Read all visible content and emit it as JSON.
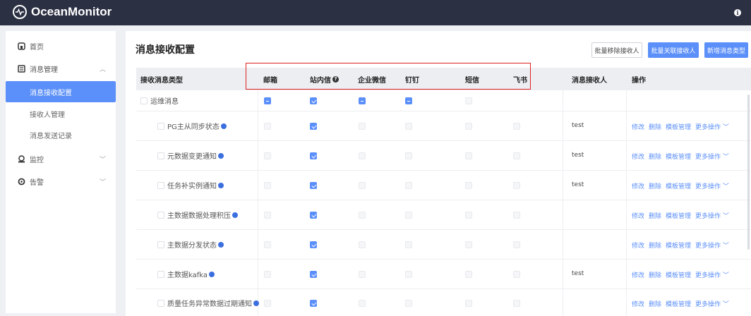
{
  "app": {
    "title": "OceanMonitor",
    "help_icon": "info-circle-icon"
  },
  "sidebar": {
    "items": [
      {
        "label": "首页",
        "icon": "home-icon"
      },
      {
        "label": "消息管理",
        "icon": "message-icon",
        "expanded": true,
        "children": [
          {
            "label": "消息接收配置",
            "active": true
          },
          {
            "label": "接收人管理"
          },
          {
            "label": "消息发送记录"
          }
        ]
      },
      {
        "label": "监控",
        "icon": "monitor-icon"
      },
      {
        "label": "告警",
        "icon": "alarm-icon"
      }
    ]
  },
  "page": {
    "title": "消息接收配置",
    "buttons": {
      "batch_remove": "批量移除接收人",
      "batch_link": "批量关联接收人",
      "add_type": "新增消息类型"
    }
  },
  "table": {
    "columns": {
      "type": "接收消息类型",
      "email": "邮箱",
      "internal": "站内信",
      "wecom": "企业微信",
      "dingtalk": "钉钉",
      "sms": "短信",
      "feishu": "飞书",
      "receiver": "消息接收人",
      "ops": "操作"
    },
    "ops_labels": {
      "edit": "修改",
      "delete": "删除",
      "template": "模板管理",
      "more": "更多操作"
    },
    "rows": [
      {
        "name": "运维消息",
        "group": true,
        "receiver": "",
        "channels": [
          "indet",
          "checked",
          "indet",
          "indet",
          "disabled",
          "none"
        ]
      },
      {
        "name": "PG主从同步状态",
        "receiver": "test",
        "channels": [
          "disabled",
          "checked",
          "disabled",
          "disabled",
          "disabled",
          "disabled"
        ]
      },
      {
        "name": "元数据变更通知",
        "receiver": "test",
        "channels": [
          "disabled",
          "checked",
          "disabled",
          "disabled",
          "disabled",
          "disabled"
        ]
      },
      {
        "name": "任务补实例通知",
        "receiver": "test",
        "channels": [
          "disabled",
          "checked",
          "disabled",
          "disabled",
          "disabled",
          "disabled"
        ]
      },
      {
        "name": "主数据数据处理积压",
        "receiver": "",
        "channels": [
          "disabled",
          "checked",
          "disabled",
          "disabled",
          "disabled",
          "disabled"
        ]
      },
      {
        "name": "主数据分发状态",
        "receiver": "",
        "channels": [
          "disabled",
          "checked",
          "disabled",
          "disabled",
          "disabled",
          "disabled"
        ]
      },
      {
        "name": "主数据kafka",
        "receiver": "test",
        "channels": [
          "disabled",
          "checked",
          "disabled",
          "disabled",
          "disabled",
          "disabled"
        ]
      },
      {
        "name": "质量任务异常数据过期通知",
        "receiver": "",
        "channels": [
          "disabled",
          "checked",
          "disabled",
          "disabled",
          "disabled",
          "disabled"
        ]
      }
    ]
  }
}
